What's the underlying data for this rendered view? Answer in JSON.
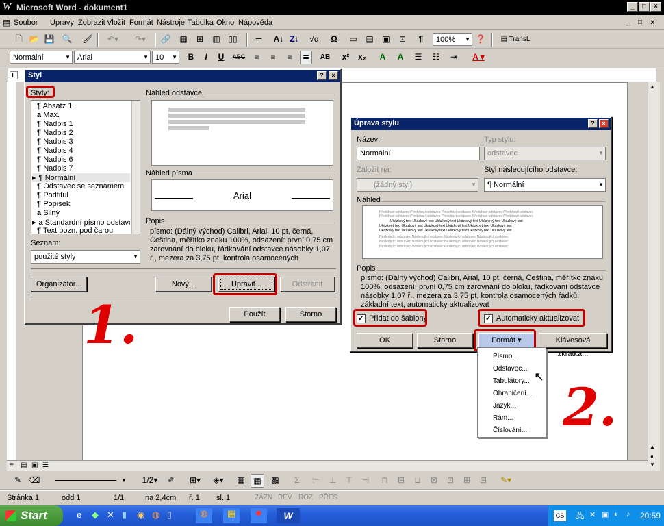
{
  "window": {
    "title": "Microsoft Word - dokument1",
    "logo": "W"
  },
  "menu": [
    "Soubor",
    "Úpravy",
    "Zobrazit",
    "Vložit",
    "Formát",
    "Nástroje",
    "Tabulka",
    "Okno",
    "Nápověda"
  ],
  "toolbar": {
    "zoom": "100%",
    "trans": "TransL"
  },
  "format_bar": {
    "style": "Normální",
    "font": "Arial",
    "size": "10"
  },
  "styl_dialog": {
    "title": "Styl",
    "styles_label": "Styly:",
    "styles": [
      {
        "icon": "¶",
        "name": "Absatz 1"
      },
      {
        "icon": "a",
        "name": "Max."
      },
      {
        "icon": "¶",
        "name": "Nadpis 1"
      },
      {
        "icon": "¶",
        "name": "Nadpis 2"
      },
      {
        "icon": "¶",
        "name": "Nadpis 3"
      },
      {
        "icon": "¶",
        "name": "Nadpis 4"
      },
      {
        "icon": "¶",
        "name": "Nadpis 6"
      },
      {
        "icon": "¶",
        "name": "Nadpis 7"
      },
      {
        "icon": "¶",
        "name": "Normální"
      },
      {
        "icon": "¶",
        "name": "Odstavec se seznamem"
      },
      {
        "icon": "¶",
        "name": "Podtitul"
      },
      {
        "icon": "¶",
        "name": "Popisek"
      },
      {
        "icon": "a",
        "name": "Silný"
      },
      {
        "icon": "a",
        "name": "Standardní písmo odstavce"
      },
      {
        "icon": "¶",
        "name": "Text pozn. pod čarou"
      }
    ],
    "list_label": "Seznam:",
    "list_value": "použité styly",
    "preview_para_label": "Náhled odstavce",
    "preview_font_label": "Náhled písma",
    "preview_font_text": "Arial",
    "desc_label": "Popis",
    "desc_text": "písmo: (Dálný východ) Calibri, Arial, 10 pt, černá, Čeština, měřítko znaku 100%, odsazení: první 0,75 cm zarovnání do bloku, řádkování odstavce násobky 1,07 ř., mezera za 3,75 pt, kontrola osamocených",
    "organizer": "Organizátor...",
    "new": "Nový...",
    "modify": "Upravit...",
    "delete": "Odstranit",
    "apply": "Použít",
    "cancel": "Storno"
  },
  "uprava_dialog": {
    "title": "Úprava stylu",
    "name_label": "Název:",
    "name_value": "Normální",
    "type_label": "Typ stylu:",
    "type_value": "odstavec",
    "based_label": "Založit na:",
    "based_value": "(žádný styl)",
    "next_label": "Styl následujícího odstavce:",
    "next_value": "¶ Normální",
    "preview_label": "Náhled",
    "preview_prev": "Předchozí odstavec Předchozí odstavec Předchozí odstavec Předchozí odstavec Předchozí odstavec",
    "preview_sample": "Ukázkový text Ukázkový text Ukázkový text Ukázkový text Ukázkový text Ukázkový text",
    "preview_next": "Následující odstavec Následující odstavec Následující odstavec Následující odstavec",
    "desc_label": "Popis",
    "desc_text": "písmo: (Dálný východ) Calibri, Arial, 10 pt, černá, Čeština, měřítko znaku 100%, odsazení: první 0,75 cm zarovnání do bloku, řádkování odstavce násobky 1,07 ř., mezera za 3,75 pt, kontrola osamocených řádků, základní text, automaticky aktualizovat",
    "add_template": "Přidat do šablony",
    "auto_update": "Automaticky aktualizovat",
    "ok": "OK",
    "cancel": "Storno",
    "format": "Formát",
    "shortcut": "Klávesová zkratka..."
  },
  "format_menu": [
    "Písmo...",
    "Odstavec...",
    "Tabulátory...",
    "Ohraničení...",
    "Jazyk...",
    "Rám...",
    "Číslování..."
  ],
  "annotations": {
    "step1": "1.",
    "step2": "2."
  },
  "status": {
    "page": "Stránka 1",
    "section": "odd 1",
    "pages": "1/1",
    "at": "na 2,4cm",
    "line": "ř. 1",
    "col": "sl. 1",
    "rec": "ZÁZN",
    "rev": "REV",
    "ext": "ROZ",
    "ovr": "PŘES"
  },
  "drawbar": {
    "zoom": "1/2"
  },
  "taskbar": {
    "start": "Start",
    "lang": "CS",
    "clock": "20:59",
    "active": "W"
  },
  "colors": {
    "title_bg": "#000000",
    "caption": "#0a246a",
    "highlight_red": "#c00000",
    "taskbar": "#245edb"
  }
}
